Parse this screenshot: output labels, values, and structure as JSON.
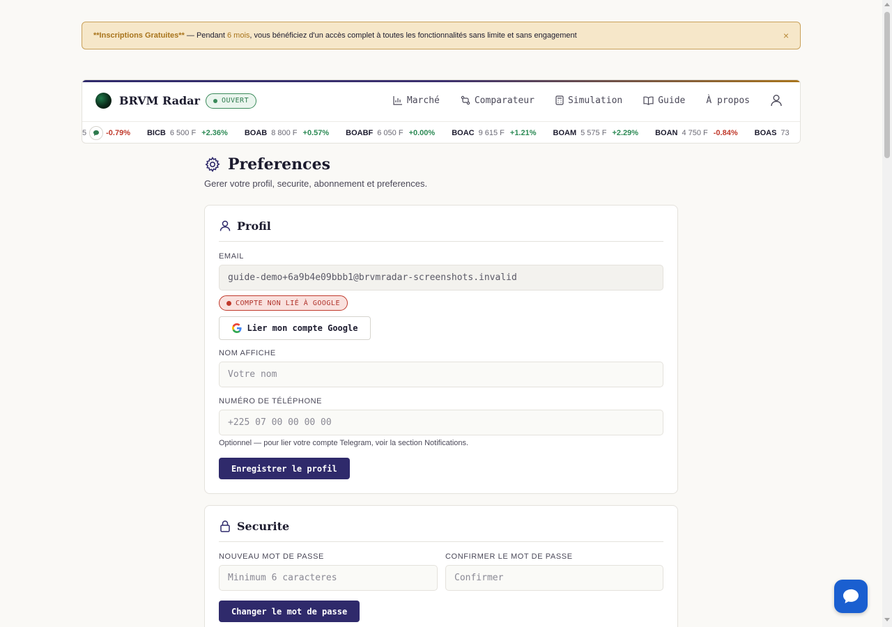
{
  "banner": {
    "highlight": "**Inscriptions Gratuites**",
    "text_before": " — Pendant ",
    "duration": "6 mois",
    "text_after": ", vous bénéficiez d'un accès complet à toutes les fonctionnalités sans limite et sans engagement",
    "close": "×"
  },
  "header": {
    "brand": "BRVM Radar",
    "status": "OUVERT",
    "nav": [
      {
        "label": "Marché",
        "icon": "bar-chart-icon"
      },
      {
        "label": "Comparateur",
        "icon": "compare-icon"
      },
      {
        "label": "Simulation",
        "icon": "calculator-icon"
      },
      {
        "label": "Guide",
        "icon": "book-icon"
      },
      {
        "label": "À propos",
        "icon": ""
      }
    ],
    "user_icon": "user-icon"
  },
  "ticker": {
    "partial_start": {
      "price_tail": "5",
      "change": "-0.79%"
    },
    "items": [
      {
        "symbol": "BICB",
        "price": "6 500 F",
        "change": "+2.36%",
        "direction": "up"
      },
      {
        "symbol": "BOAB",
        "price": "8 800 F",
        "change": "+0.57%",
        "direction": "up"
      },
      {
        "symbol": "BOABF",
        "price": "6 050 F",
        "change": "+0.00%",
        "direction": "up"
      },
      {
        "symbol": "BOAC",
        "price": "9 615 F",
        "change": "+1.21%",
        "direction": "up"
      },
      {
        "symbol": "BOAM",
        "price": "5 575 F",
        "change": "+2.29%",
        "direction": "up"
      },
      {
        "symbol": "BOAN",
        "price": "4 750 F",
        "change": "-0.84%",
        "direction": "down"
      }
    ],
    "partial_end": {
      "symbol": "BOAS",
      "price": "73"
    }
  },
  "page": {
    "title": "Preferences",
    "subtitle": "Gerer votre profil, securite, abonnement et preferences."
  },
  "profile": {
    "title": "Profil",
    "email_label": "EMAIL",
    "email_value": "guide-demo+6a9b4e09bbb1@brvmradar-screenshots.invalid",
    "google_status": "COMPTE NON LIÉ À GOOGLE",
    "google_button": "Lier mon compte Google",
    "name_label": "NOM AFFICHE",
    "name_placeholder": "Votre nom",
    "phone_label": "NUMÉRO DE TÉLÉPHONE",
    "phone_placeholder": "+225 07 00 00 00 00",
    "phone_hint": "Optionnel — pour lier votre compte Telegram, voir la section Notifications.",
    "save_button": "Enregistrer le profil"
  },
  "security": {
    "title": "Securite",
    "new_pw_label": "NOUVEAU MOT DE PASSE",
    "new_pw_placeholder": "Minimum 6 caracteres",
    "confirm_label": "CONFIRMER LE MOT DE PASSE",
    "confirm_placeholder": "Confirmer",
    "change_button": "Changer le mot de passe"
  },
  "colors": {
    "primary": "#2f2a6b",
    "up": "#2d8a55",
    "down": "#c0392b",
    "chat": "#1a5fd0",
    "banner_bg": "#f6e7c9"
  }
}
